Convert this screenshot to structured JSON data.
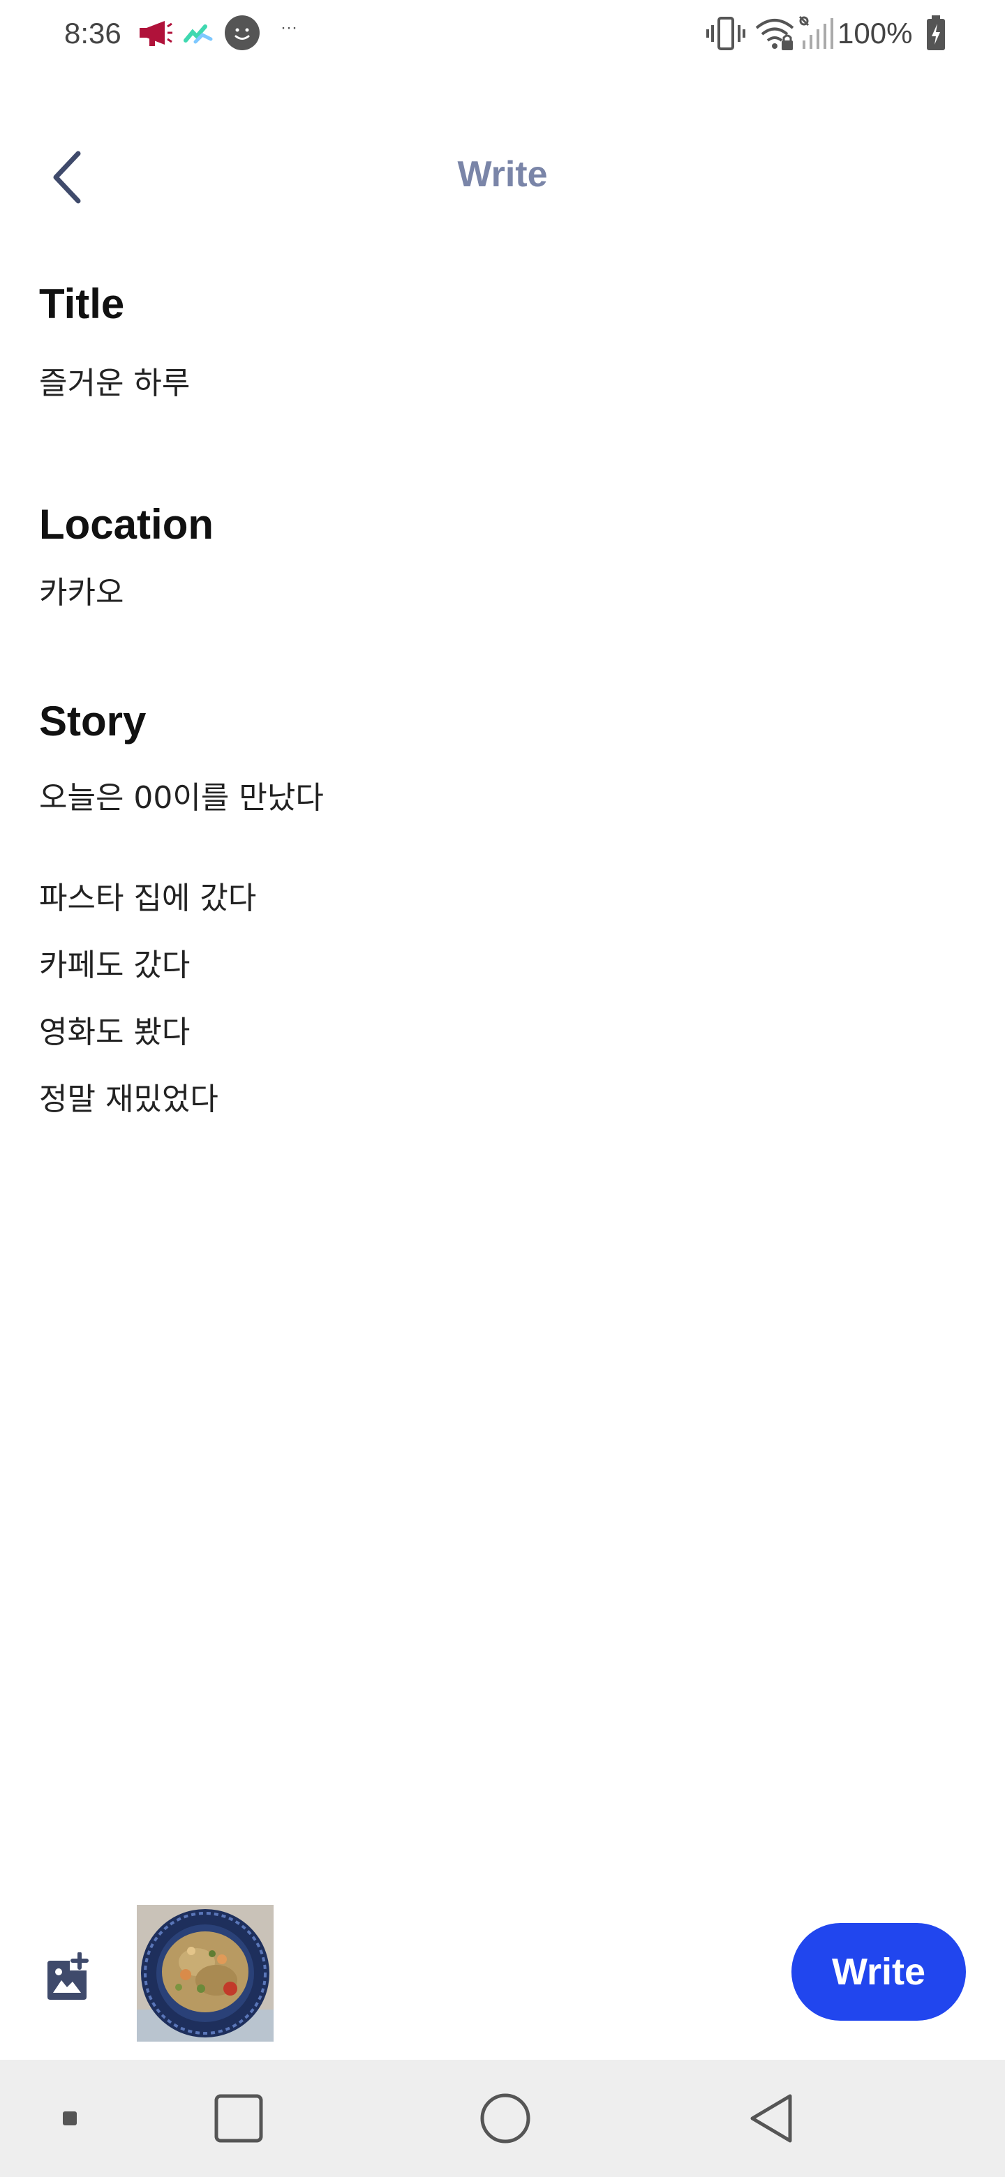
{
  "status_bar": {
    "time": "8:36",
    "more_indicator": "···",
    "battery_percent": "100%",
    "icons": [
      "megaphone-icon",
      "app-notification-icon",
      "face-icon",
      "vibrate-icon",
      "wifi-icon",
      "signal-icon",
      "battery-icon"
    ]
  },
  "header": {
    "title": "Write",
    "back_icon": "chevron-left-icon"
  },
  "form": {
    "title_label": "Title",
    "title_value": "즐거운 하루",
    "location_label": "Location",
    "location_value": "카카오",
    "story_label": "Story",
    "story_lines": [
      "오늘은 00이를 만났다",
      "파스타 집에 갔다",
      "카페도 갔다",
      "영화도 봤다",
      "정말 재밌었다"
    ]
  },
  "toolbar": {
    "add_image_icon": "add-photo-icon",
    "write_label": "Write"
  },
  "nav_bar": {
    "icons": [
      "dot-icon",
      "recent-apps-icon",
      "home-icon",
      "back-icon"
    ]
  },
  "colors": {
    "accent": "#2146ee",
    "header_title": "#7a85a8",
    "icon_dark": "#3f4a6b",
    "nav_background": "#eeeeee"
  }
}
